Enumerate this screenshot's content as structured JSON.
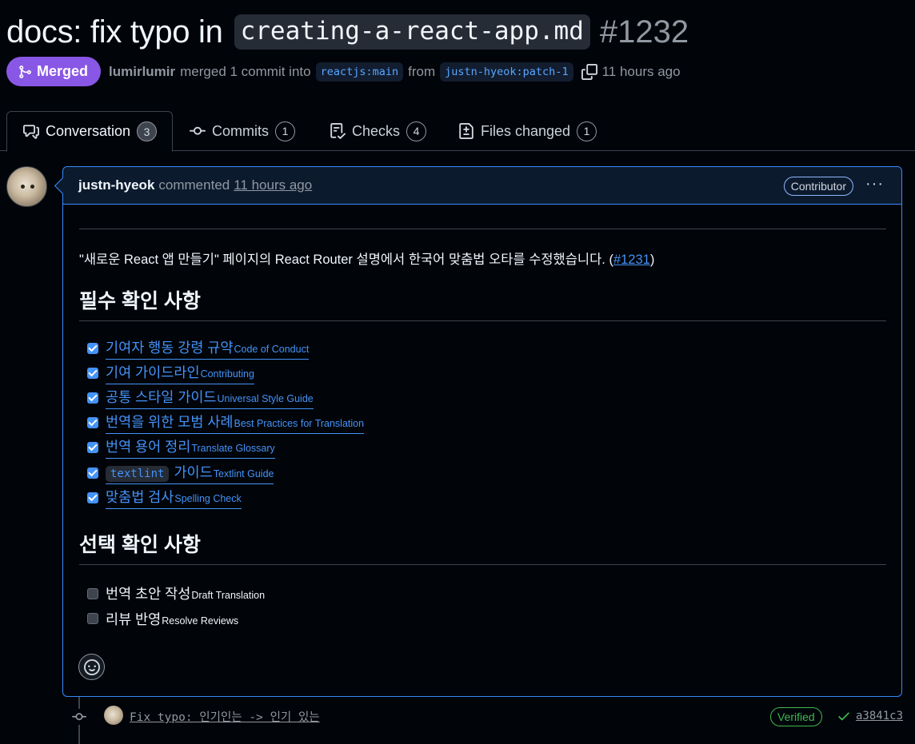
{
  "pr": {
    "title_prefix": "docs: fix typo in",
    "title_code": "creating-a-react-app.md",
    "number": "#1232",
    "status_label": "Merged",
    "merger": "lumirlumir",
    "merge_text": "merged 1 commit into",
    "base_branch": "reactjs:main",
    "from_text": "from",
    "head_branch": "justn-hyeok:patch-1",
    "time_ago": "11 hours ago",
    "accent_merged": "#8957e5"
  },
  "tabs": [
    {
      "label": "Conversation",
      "count": "3",
      "icon": "comment-discussion-icon",
      "active": true
    },
    {
      "label": "Commits",
      "count": "1",
      "icon": "git-commit-icon"
    },
    {
      "label": "Checks",
      "count": "4",
      "icon": "checklist-icon"
    },
    {
      "label": "Files changed",
      "count": "1",
      "icon": "file-diff-icon"
    }
  ],
  "comment": {
    "author": "justn-hyeok",
    "action": "commented",
    "time": "11 hours ago",
    "badge": "Contributor",
    "menu": "···",
    "intro_text": "\"새로운 React 앱 만들기\" 페이지의 React Router 설명에서 한국어 맞춤법 오타를 수정했습니다. (",
    "intro_link": "#1231",
    "intro_close": ")",
    "required_heading": "필수 확인 사항",
    "required_items": [
      {
        "label": "기여자 행동 강령 규약",
        "sup": "Code of Conduct",
        "checked": true
      },
      {
        "label": "기여 가이드라인",
        "sup": "Contributing",
        "checked": true
      },
      {
        "label": "공통 스타일 가이드",
        "sup": "Universal Style Guide",
        "checked": true
      },
      {
        "label": "번역을 위한 모범 사례",
        "sup": "Best Practices for Translation",
        "checked": true
      },
      {
        "label": "번역 용어 정리",
        "sup": "Translate Glossary",
        "checked": true
      },
      {
        "code": "textlint",
        "label": "가이드",
        "sup": "Textlint Guide",
        "checked": true
      },
      {
        "label": "맞춤법 검사",
        "sup": "Spelling Check",
        "checked": true
      }
    ],
    "optional_heading": "선택 확인 사항",
    "optional_items": [
      {
        "label": "번역 초안 작성",
        "sup": "Draft Translation",
        "checked": false
      },
      {
        "label": "리뷰 반영",
        "sup": "Resolve Reviews",
        "checked": false
      }
    ]
  },
  "commit": {
    "message": "Fix typo: 인기인는 -> 인기 있는",
    "verified": "Verified",
    "sha": "a3841c3"
  }
}
